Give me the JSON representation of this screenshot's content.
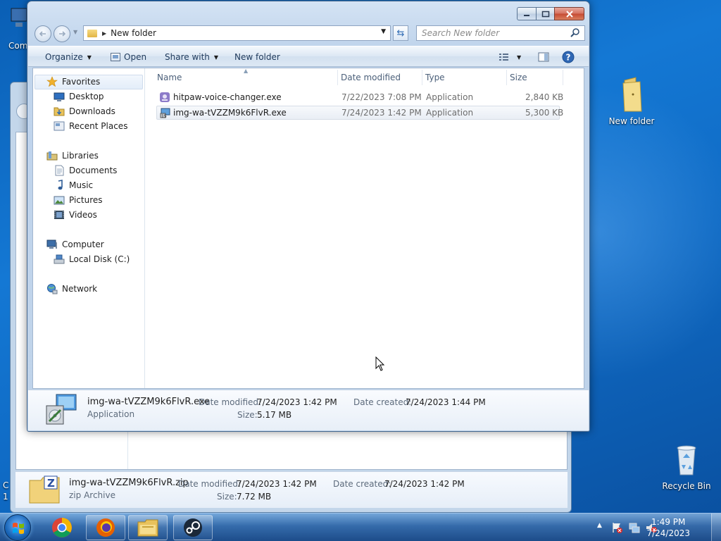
{
  "desktop": {
    "partial_left_top": "Com",
    "partial_left_bottom": "C",
    "partial_left_bottom2": "1",
    "icons": [
      {
        "label": "New folder"
      },
      {
        "label": "Recycle Bin"
      }
    ]
  },
  "background_window": {
    "details": {
      "file_name": "img-wa-tVZZM9k6FlvR.zip",
      "type": "zip Archive",
      "date_modified_label": "Date modified:",
      "date_modified": "7/24/2023 1:42 PM",
      "date_created_label": "Date created:",
      "date_created": "7/24/2023 1:42 PM",
      "size_label": "Size:",
      "size": "7.72 MB"
    }
  },
  "window": {
    "address": {
      "path": "New folder"
    },
    "search": {
      "placeholder": "Search New folder"
    },
    "toolbar": {
      "organize": "Organize",
      "open": "Open",
      "share_with": "Share with",
      "new_folder": "New folder"
    },
    "nav": {
      "favorites": "Favorites",
      "desktop": "Desktop",
      "downloads": "Downloads",
      "recent_places": "Recent Places",
      "libraries": "Libraries",
      "documents": "Documents",
      "music": "Music",
      "pictures": "Pictures",
      "videos": "Videos",
      "computer": "Computer",
      "local_disk": "Local Disk (C:)",
      "network": "Network"
    },
    "columns": {
      "name": "Name",
      "date_modified": "Date modified",
      "type": "Type",
      "size": "Size"
    },
    "files": [
      {
        "name": "hitpaw-voice-changer.exe",
        "date_modified": "7/22/2023 7:08 PM",
        "type": "Application",
        "size": "2,840 KB"
      },
      {
        "name": "img-wa-tVZZM9k6FlvR.exe",
        "date_modified": "7/24/2023 1:42 PM",
        "type": "Application",
        "size": "5,300 KB"
      }
    ],
    "details": {
      "file_name": "img-wa-tVZZM9k6FlvR.exe",
      "type": "Application",
      "date_modified_label": "Date modified:",
      "date_modified": "7/24/2023 1:42 PM",
      "date_created_label": "Date created:",
      "date_created": "7/24/2023 1:44 PM",
      "size_label": "Size:",
      "size": "5.17 MB"
    }
  },
  "taskbar": {
    "pinned": [
      "start-button",
      "chrome",
      "firefox",
      "windows-explorer",
      "steam"
    ],
    "clock": {
      "time": "1:49 PM",
      "date": "7/24/2023"
    }
  }
}
